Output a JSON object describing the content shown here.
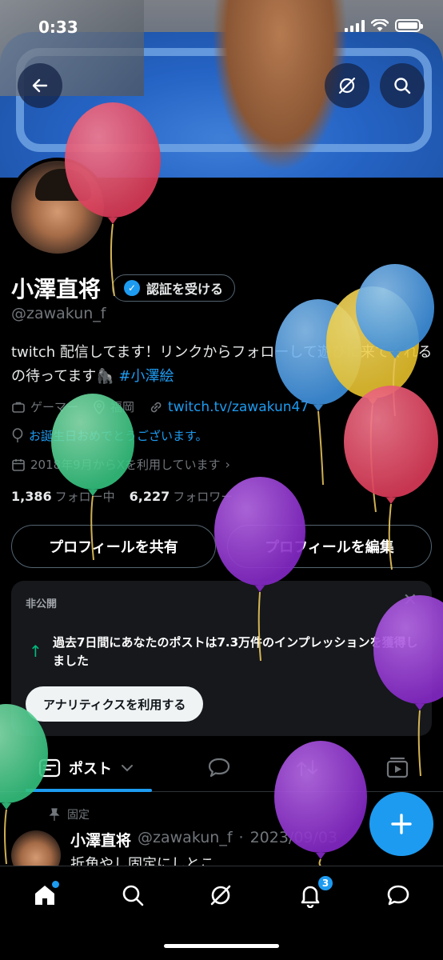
{
  "status_bar": {
    "time": "0:33"
  },
  "profile": {
    "name": "小澤直将",
    "verify_label": "認証を受ける",
    "handle": "@zawakun_f",
    "bio_text": "twitch 配信してます！リンクからフォローして遊びに来てくれるの待ってます🦍",
    "bio_hashtag": "#小澤絵",
    "category": "ゲーマー",
    "location": "福岡",
    "link": "twitch.tv/zawakun47",
    "birthday": "お誕生日おめでとうございます。",
    "joined": "2018年9月からXを利用しています",
    "following_count": "1,386",
    "following_label": "フォロー中",
    "followers_count": "6,227",
    "followers_label": "フォロワー"
  },
  "buttons": {
    "share_profile": "プロフィールを共有",
    "edit_profile": "プロフィールを編集"
  },
  "analytics_card": {
    "private_label": "非公開",
    "message": "過去7日間にあなたのポストは7.3万件のインプレッションを獲得しました",
    "cta": "アナリティクスを利用する"
  },
  "tabs": {
    "posts_label": "ポスト"
  },
  "pinned_post": {
    "pinned_label": "固定",
    "author_name": "小澤直将",
    "author_handle": "@zawakun_f",
    "date": "2023/09/03",
    "text": "折角やし固定にしとこ"
  },
  "nav": {
    "notifications_badge": "3"
  },
  "colors": {
    "accent": "#1d9bf0",
    "background": "#000000",
    "muted": "#71767b"
  }
}
